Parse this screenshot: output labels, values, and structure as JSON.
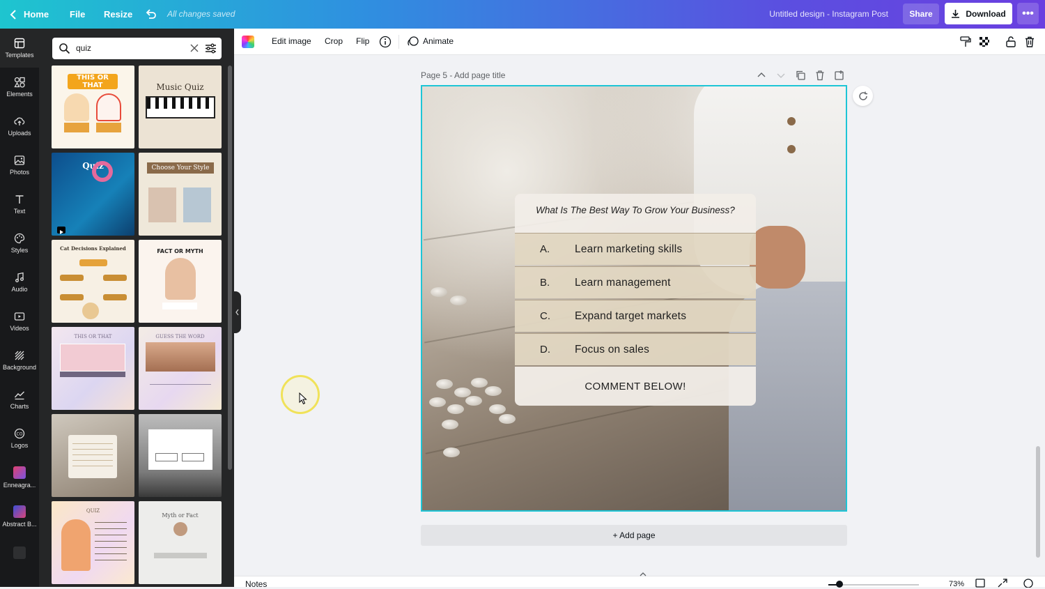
{
  "topbar": {
    "home": "Home",
    "file": "File",
    "resize": "Resize",
    "saved_status": "All changes saved",
    "doc_title": "Untitled design - Instagram Post",
    "share": "Share",
    "download": "Download"
  },
  "rail": [
    {
      "label": "Templates",
      "icon": "template-icon"
    },
    {
      "label": "Elements",
      "icon": "shapes-icon"
    },
    {
      "label": "Uploads",
      "icon": "cloud-upload-icon"
    },
    {
      "label": "Photos",
      "icon": "image-icon"
    },
    {
      "label": "Text",
      "icon": "text-icon"
    },
    {
      "label": "Styles",
      "icon": "palette-icon"
    },
    {
      "label": "Audio",
      "icon": "music-note-icon"
    },
    {
      "label": "Videos",
      "icon": "video-icon"
    },
    {
      "label": "Background",
      "icon": "pattern-icon"
    },
    {
      "label": "Charts",
      "icon": "chart-icon"
    },
    {
      "label": "Logos",
      "icon": "logo-icon"
    },
    {
      "label": "Enneagra...",
      "icon": "app-thumb-icon"
    },
    {
      "label": "Abstract B...",
      "icon": "app-thumb-icon"
    }
  ],
  "search": {
    "value": "quiz"
  },
  "templates": [
    {
      "label": "THIS OR THAT"
    },
    {
      "label": "Music Quiz"
    },
    {
      "label": "Quiz"
    },
    {
      "label": "Choose Your Style"
    },
    {
      "label": "Cat Decisions Explained"
    },
    {
      "label": "FACT OR MYTH"
    },
    {
      "label": "THIS OR THAT"
    },
    {
      "label": "GUESS THE WORD"
    },
    {
      "label": ""
    },
    {
      "label": ""
    },
    {
      "label": "QUIZ"
    },
    {
      "label": "Myth or Fact"
    }
  ],
  "toolbar": {
    "edit_image": "Edit image",
    "crop": "Crop",
    "flip": "Flip",
    "animate": "Animate"
  },
  "page": {
    "heading": "Page 5 - Add page title",
    "add_page": "+ Add page"
  },
  "quiz": {
    "question": "What Is The Best Way To Grow Your Business?",
    "options": [
      {
        "letter": "A.",
        "text": "Learn marketing skills"
      },
      {
        "letter": "B.",
        "text": "Learn management"
      },
      {
        "letter": "C.",
        "text": "Expand target markets"
      },
      {
        "letter": "D.",
        "text": "Focus on sales"
      }
    ],
    "footer": "COMMENT BELOW!"
  },
  "bottom": {
    "notes": "Notes",
    "zoom": "73%",
    "zoom_level": 0.73
  },
  "colors": {
    "selection": "#1dc5d6",
    "rail_bg": "#18191b",
    "panel_bg": "#252627"
  }
}
